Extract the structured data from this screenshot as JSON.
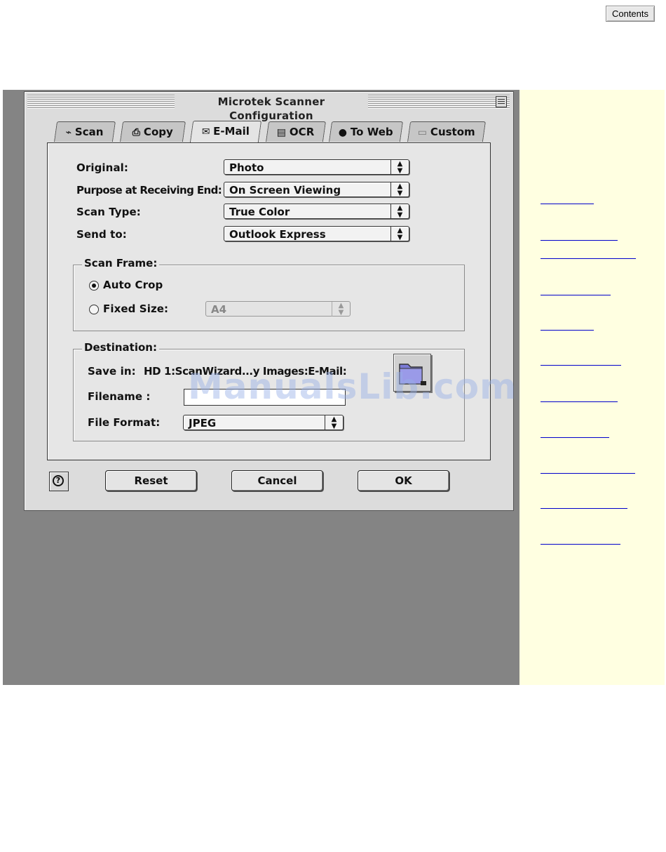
{
  "page": {
    "contents_button": "Contents",
    "watermark": "ManualsLib.com"
  },
  "window": {
    "title": "Microtek Scanner Configuration",
    "tabs": [
      {
        "label": "Scan",
        "icon": "scanner-icon"
      },
      {
        "label": "Copy",
        "icon": "printer-icon"
      },
      {
        "label": "E-Mail",
        "icon": "email-icon",
        "active": true
      },
      {
        "label": "OCR",
        "icon": "ocr-icon"
      },
      {
        "label": "To Web",
        "icon": "globe-icon"
      },
      {
        "label": "Custom",
        "icon": "folder-icon"
      }
    ],
    "fields": {
      "original": {
        "label": "Original:",
        "value": "Photo"
      },
      "purpose": {
        "label": "Purpose at Receiving End:",
        "value": "On Screen Viewing"
      },
      "scan_type": {
        "label": "Scan Type:",
        "value": "True Color"
      },
      "send_to": {
        "label": "Send to:",
        "value": "Outlook Express"
      }
    },
    "scan_frame": {
      "title": "Scan Frame:",
      "auto_crop": "Auto Crop",
      "fixed_size": "Fixed Size:",
      "fixed_size_value": "A4",
      "selected": "auto_crop"
    },
    "destination": {
      "title": "Destination:",
      "save_in_label": "Save in:",
      "save_in_path": "HD 1:ScanWizard...y Images:E-Mail:",
      "filename_label": "Filename :",
      "filename_value": "",
      "file_format_label": "File Format:",
      "file_format_value": "JPEG"
    },
    "buttons": {
      "reset": "Reset",
      "cancel": "Cancel",
      "ok": "OK"
    }
  },
  "sidebar_links": 10
}
